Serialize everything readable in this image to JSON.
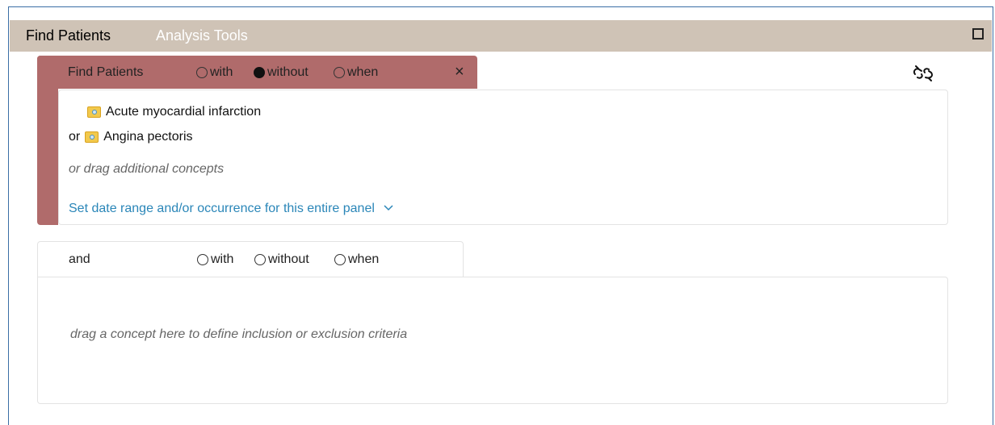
{
  "tabs": {
    "active": "Find Patients",
    "inactive": "Analysis Tools"
  },
  "panel1": {
    "label": "Find Patients",
    "options": [
      "with",
      "without",
      "when"
    ],
    "selected": "without",
    "close_symbol": "×",
    "concepts": [
      {
        "prefix": "",
        "name": "Acute myocardial infarction",
        "icon": "concept-folder-icon"
      },
      {
        "prefix": "or",
        "name": "Angina pectoris",
        "icon": "concept-folder-icon"
      }
    ],
    "drag_hint": "or drag additional concepts",
    "date_range_link": "Set date range and/or occurrence for this entire panel",
    "accent_color": "#b06b6b"
  },
  "panel2": {
    "label": "and",
    "options": [
      "with",
      "without",
      "when"
    ],
    "drag_hint": "drag a concept here to define inclusion or exclusion criteria"
  },
  "icons": {
    "expand": "expand-icon",
    "unlink": "unlink-icon",
    "chevron": "chevron-down-icon"
  },
  "colors": {
    "tabbar": "#cfc3b6",
    "link": "#2a86b8",
    "frame_border": "#3a6ea5"
  }
}
